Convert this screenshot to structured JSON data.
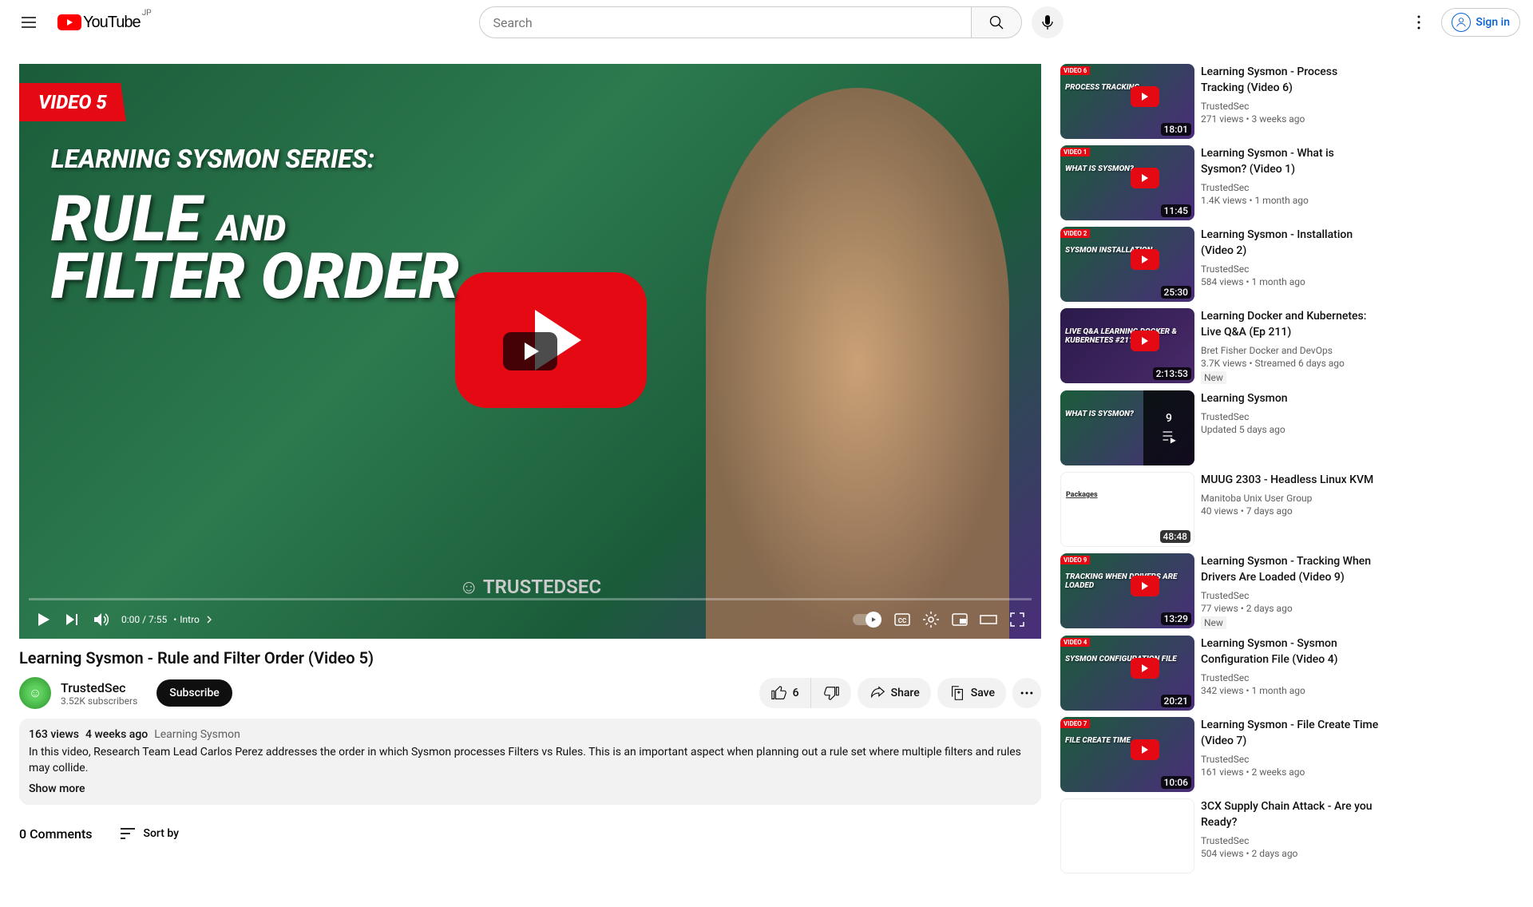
{
  "header": {
    "country": "JP",
    "logo_text": "YouTube",
    "search_placeholder": "Search",
    "signin": "Sign in"
  },
  "player": {
    "badge": "VIDEO 5",
    "overlay_title_1": "LEARNING SYSMON SERIES:",
    "overlay_title_2a": "RULE",
    "overlay_title_2b": "AND",
    "overlay_title_2c": "FILTER ORDER",
    "brand": "☺ TRUSTEDSEC",
    "time": "0:00 / 7:55",
    "chapter_label": "Intro",
    "chapter_bullet": "•"
  },
  "video": {
    "title": "Learning Sysmon - Rule and Filter Order (Video 5)",
    "channel": "TrustedSec",
    "subscribers": "3.52K subscribers",
    "subscribe": "Subscribe",
    "like_count": "6",
    "share": "Share",
    "save": "Save"
  },
  "description": {
    "views": "163 views",
    "date": "4 weeks ago",
    "tag": "Learning Sysmon",
    "text": "In this video, Research Team Lead Carlos Perez addresses the order in which Sysmon processes Filters vs Rules. This is an important aspect when planning out a rule set where multiple filters and rules may collide.",
    "show_more": "Show more"
  },
  "comments": {
    "count": "0 Comments",
    "sort": "Sort by"
  },
  "related": [
    {
      "title": "Learning Sysmon - Process Tracking (Video 6)",
      "channel": "TrustedSec",
      "meta": "271 views  •  3 weeks ago",
      "duration": "18:01",
      "badge": "VIDEO 6",
      "thumb_text": "PROCESS\nTRACKING"
    },
    {
      "title": "Learning Sysmon - What is Sysmon? (Video 1)",
      "channel": "TrustedSec",
      "meta": "1.4K views  •  1 month ago",
      "duration": "11:45",
      "badge": "VIDEO 1",
      "thumb_text": "WHAT IS\nSYSMON?"
    },
    {
      "title": "Learning Sysmon - Installation (Video 2)",
      "channel": "TrustedSec",
      "meta": "584 views  •  1 month ago",
      "duration": "25:30",
      "badge": "VIDEO 2",
      "thumb_text": "SYSMON\nINSTALLATION"
    },
    {
      "title": "Learning Docker and Kubernetes: Live Q&A (Ep 211)",
      "channel": "Bret Fisher Docker and DevOps",
      "meta": "3.7K views  •  Streamed 6 days ago",
      "duration": "2:13:53",
      "new": "New",
      "thumb_text": "LIVE Q&A\nLEARNING\nDOCKER &\nKUBERNETES\n#211",
      "alt_bg": true
    },
    {
      "title": "Learning Sysmon",
      "channel": "TrustedSec",
      "meta": "Updated 5 days ago",
      "playlist_count": "9",
      "thumb_text": "WHAT IS\nSYSMON?"
    },
    {
      "title": "MUUG 2303 - Headless Linux KVM",
      "channel": "Manitoba Unix User Group",
      "meta": "40 views  •  7 days ago",
      "duration": "48:48",
      "white_bg": true,
      "thumb_text": "Packages"
    },
    {
      "title": "Learning Sysmon - Tracking When Drivers Are Loaded (Video 9)",
      "channel": "TrustedSec",
      "meta": "77 views  •  2 days ago",
      "duration": "13:29",
      "new": "New",
      "badge": "VIDEO 9",
      "thumb_text": "TRACKING WHEN\nDRIVERS ARE LOADED"
    },
    {
      "title": "Learning Sysmon - Sysmon Configuration File (Video 4)",
      "channel": "TrustedSec",
      "meta": "342 views  •  1 month ago",
      "duration": "20:21",
      "badge": "VIDEO 4",
      "thumb_text": "SYSMON\nCONFIGURATION\nFILE"
    },
    {
      "title": "Learning Sysmon - File Create Time (Video 7)",
      "channel": "TrustedSec",
      "meta": "161 views  •  2 weeks ago",
      "duration": "10:06",
      "badge": "VIDEO 7",
      "thumb_text": "FILE CREATE\nTIME"
    },
    {
      "title": "3CX Supply Chain Attack - Are you Ready?",
      "channel": "TrustedSec",
      "meta": "504 views  •  2 days ago",
      "duration": "",
      "thumb_text": "",
      "white_bg": true
    }
  ]
}
